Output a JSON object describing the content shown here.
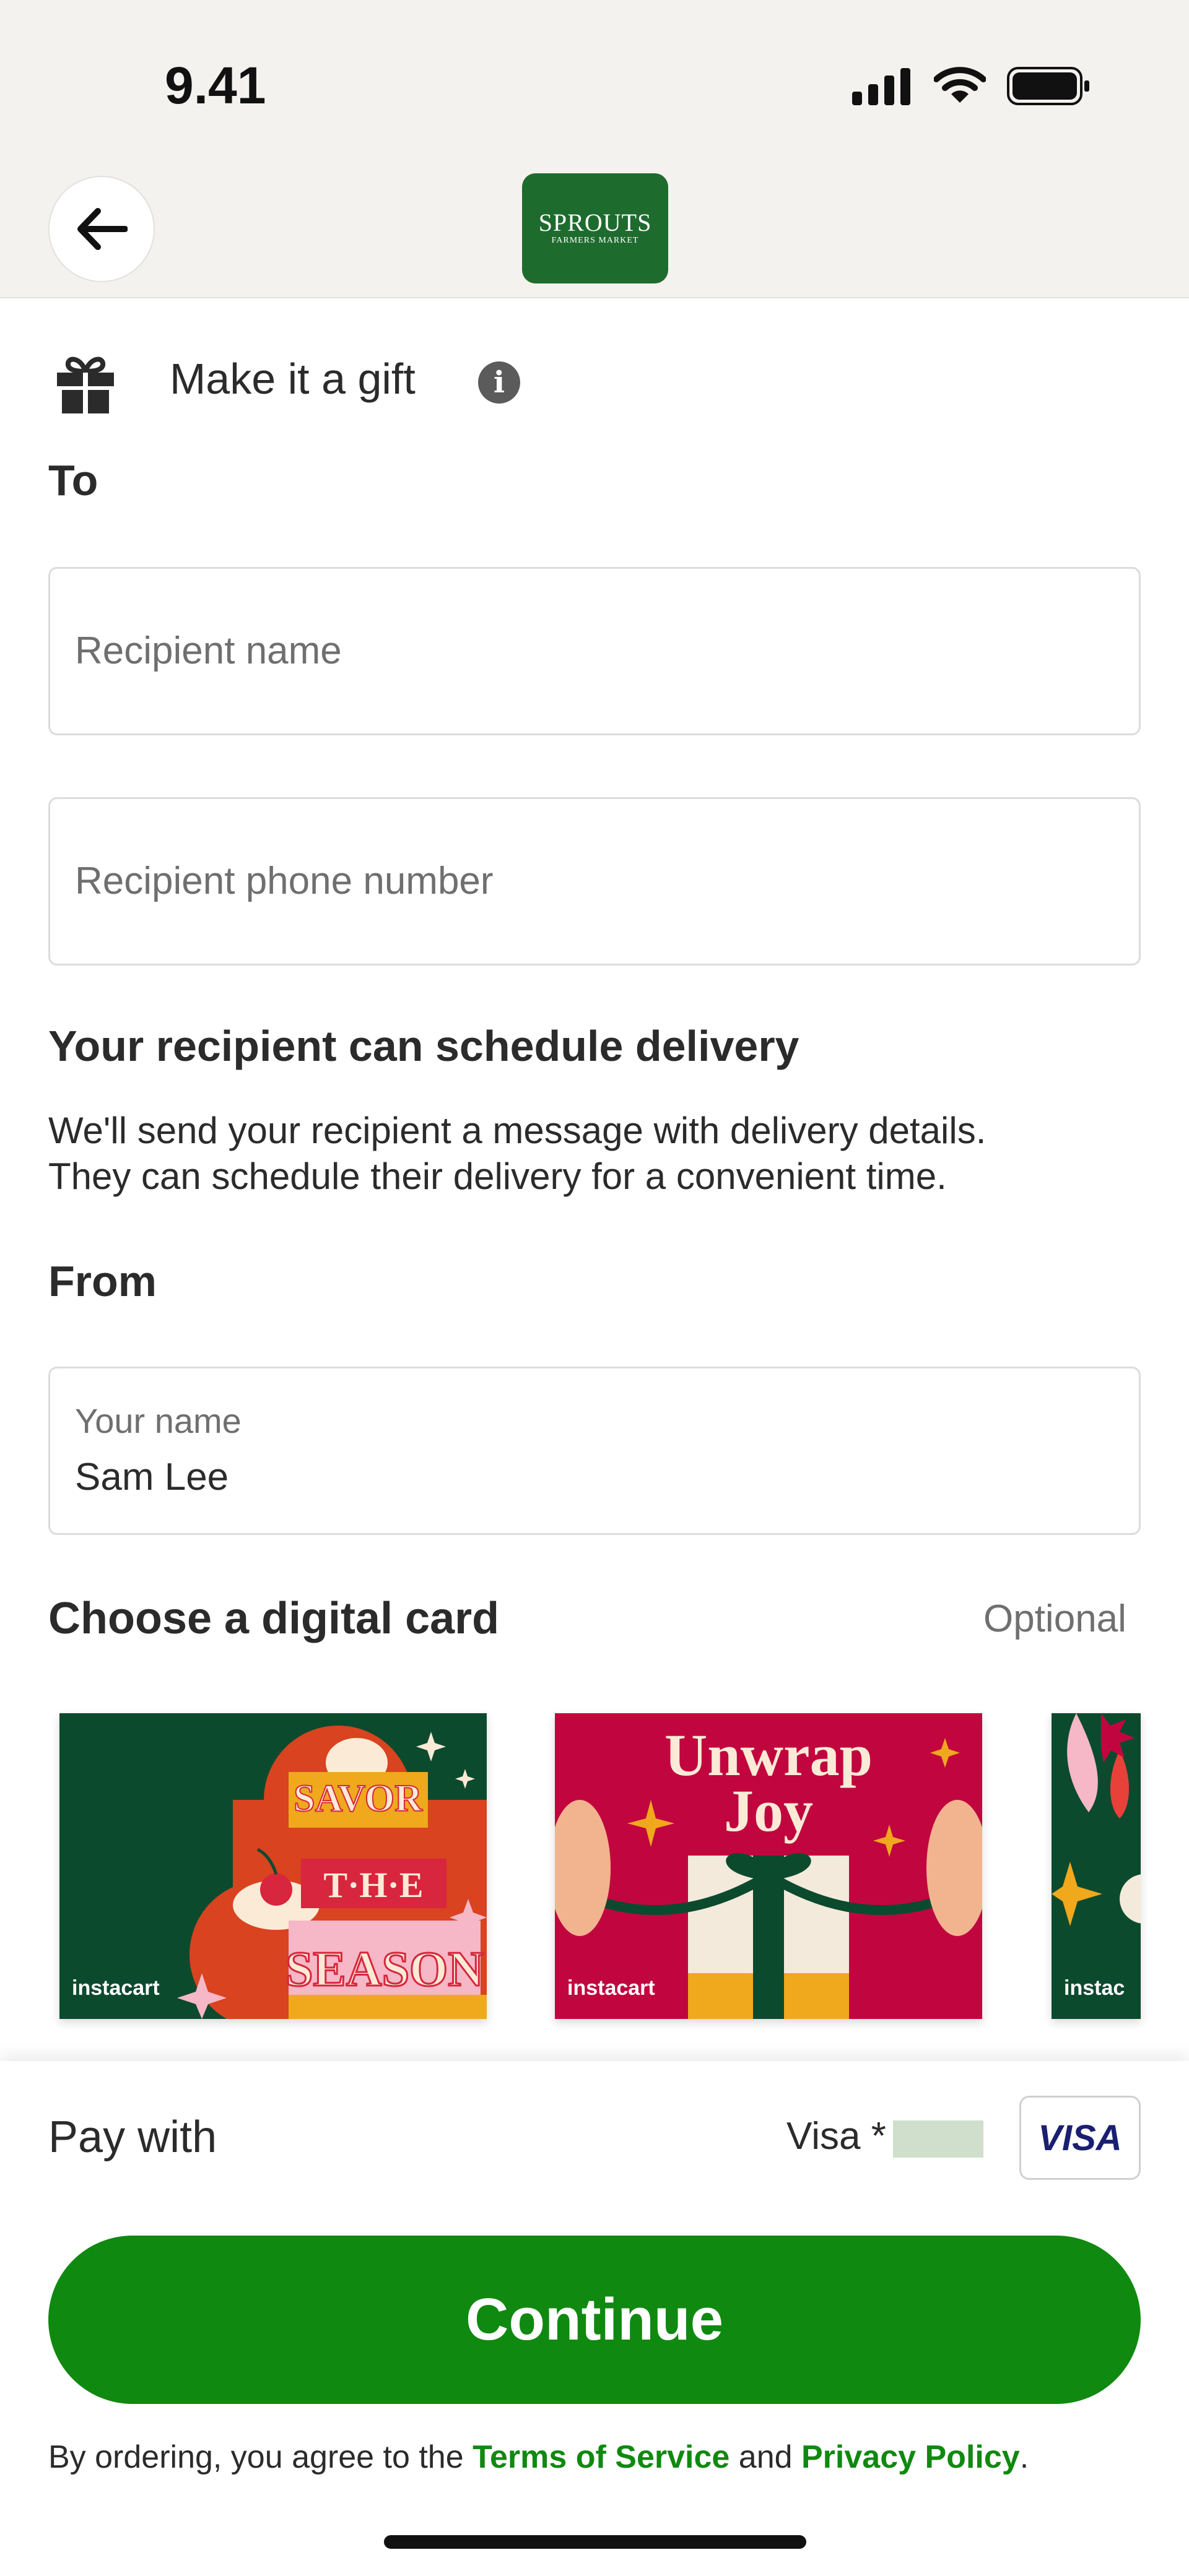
{
  "status_bar": {
    "time": "9.41"
  },
  "header": {
    "store_logo_line1": "SPROUTS",
    "store_logo_line2": "FARMERS MARKET"
  },
  "gift": {
    "title": "Make it a gift"
  },
  "to": {
    "label": "To",
    "recipient_name_placeholder": "Recipient name",
    "recipient_phone_placeholder": "Recipient phone number"
  },
  "schedule": {
    "title": "Your recipient can schedule delivery",
    "line1": "We'll send your recipient a message with delivery details.",
    "line2": "They can schedule their delivery for a convenient time."
  },
  "from": {
    "label": "From",
    "name_label": "Your name",
    "name_value": "Sam Lee"
  },
  "digital_card": {
    "title": "Choose a digital card",
    "optional": "Optional",
    "cards": [
      {
        "text_1": "SAVOR",
        "text_2": "T·H·E",
        "text_3": "SEASON",
        "brand": "instacart"
      },
      {
        "text_1": "Unwrap",
        "text_2": "Joy",
        "brand": "instacart"
      },
      {
        "brand": "instac"
      }
    ]
  },
  "payment": {
    "label": "Pay with",
    "card_text": "Visa *",
    "card_brand": "VISA"
  },
  "continue_label": "Continue",
  "legal": {
    "prefix": "By ordering, you agree to the ",
    "terms": "Terms of Service",
    "and": " and ",
    "privacy": "Privacy Policy",
    "suffix": "."
  },
  "colors": {
    "accent": "#108910",
    "header_bg": "#f4f2ee",
    "logo_bg": "#1e6b2e"
  }
}
